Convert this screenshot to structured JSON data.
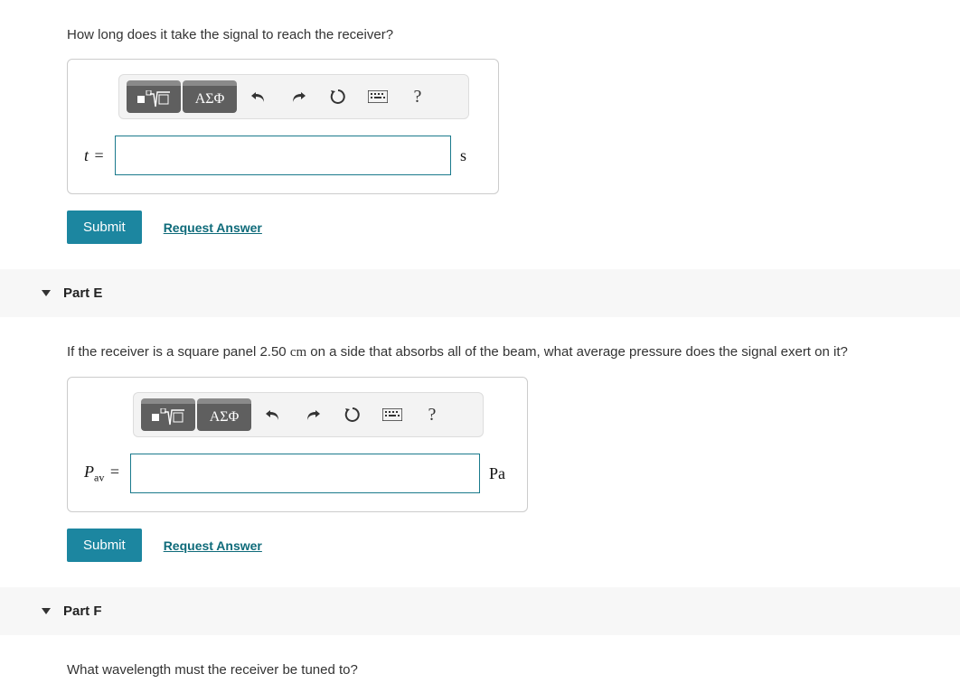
{
  "partD": {
    "question": "How long does it take the signal to reach the receiver?",
    "var_symbol": "t",
    "unit": "s"
  },
  "partE": {
    "header": "Part E",
    "question_pre": "If the receiver is a square panel 2.50 ",
    "question_dim": "cm",
    "question_post": " on a side that absorbs all of the beam, what average pressure does the signal exert on it?",
    "var_symbol": "P",
    "var_sub": "av",
    "unit": "Pa"
  },
  "partF": {
    "header": "Part F",
    "question": "What wavelength must the receiver be tuned to?"
  },
  "toolbar": {
    "greek": "ΑΣΦ",
    "help": "?"
  },
  "actions": {
    "submit": "Submit",
    "request": "Request Answer"
  }
}
